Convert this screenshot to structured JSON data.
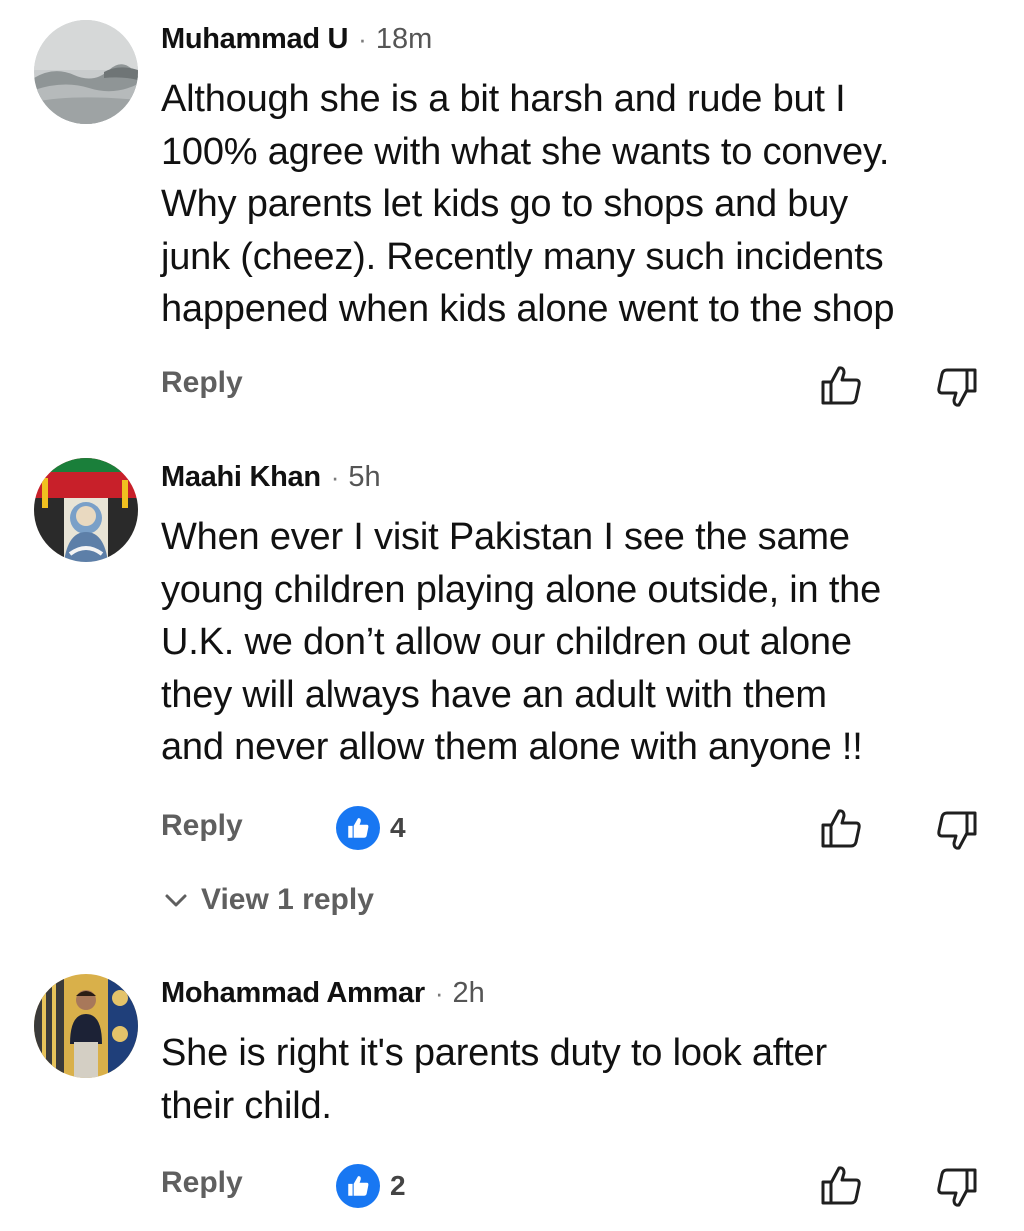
{
  "comments": [
    {
      "author": "Muhammad U",
      "separator": "·",
      "time": "18m",
      "lines": [
        "Although she is a bit harsh and rude but I",
        "100% agree with what she wants to convey.",
        "Why parents let kids go to shops and buy",
        "junk (cheez). Recently many such incidents",
        "happened when kids alone went to the shop"
      ],
      "reply_label": "Reply",
      "avatar_icon": "landscape-avatar"
    },
    {
      "author": "Maahi Khan",
      "separator": "·",
      "time": "5h",
      "lines": [
        "When ever I visit Pakistan I see the same",
        "young children playing alone outside, in the",
        "U.K. we don’t allow our children out alone",
        "they will always have an adult with them",
        "and never allow them alone with anyone !!"
      ],
      "reply_label": "Reply",
      "like_count": "4",
      "view_replies_label": "View 1 reply",
      "avatar_icon": "figure-avatar"
    },
    {
      "author": "Mohammad Ammar",
      "separator": "·",
      "time": "2h",
      "lines": [
        "She is right it's parents duty to look after",
        "their child."
      ],
      "reply_label": "Reply",
      "like_count": "2",
      "avatar_icon": "person-avatar"
    }
  ],
  "icons": {
    "like": "thumbs-up-outline-icon",
    "dislike": "thumbs-down-outline-icon",
    "like_badge": "thumbs-up-filled-icon",
    "expand": "chevron-down-icon"
  },
  "colors": {
    "accent": "#1877f2",
    "text": "#111111",
    "muted": "#5f5f5f"
  }
}
